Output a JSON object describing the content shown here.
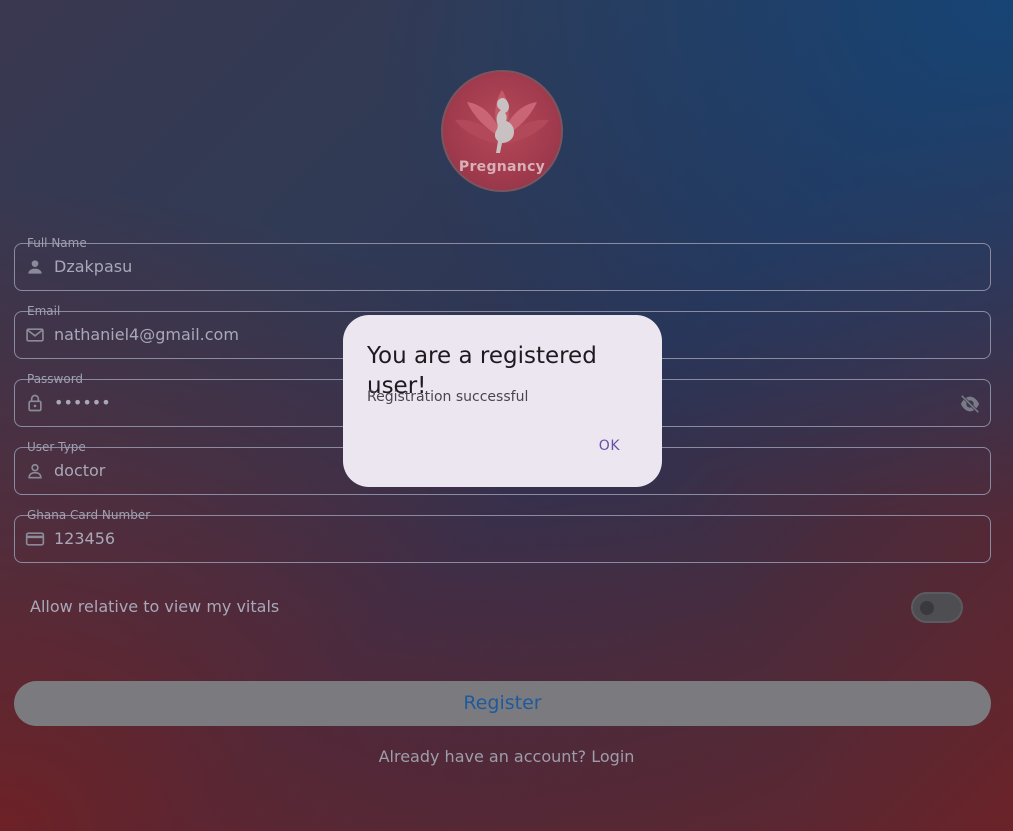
{
  "logo": {
    "text": "Pregnancy"
  },
  "fields": {
    "full_name": {
      "label": "Full Name",
      "value": "Dzakpasu",
      "icon": "person-icon"
    },
    "email": {
      "label": "Email",
      "value": "nathaniel4@gmail.com",
      "icon": "mail-icon"
    },
    "password": {
      "label": "Password",
      "value": "••••••",
      "icon": "lock-icon",
      "trailing_icon": "visibility-off-icon"
    },
    "user_type": {
      "label": "User Type",
      "value": "doctor",
      "icon": "person-icon"
    },
    "ghana_card": {
      "label": "Ghana Card Number",
      "value": "123456",
      "icon": "credit-card-icon"
    }
  },
  "toggle": {
    "label": "Allow relative to view my vitals",
    "on": false
  },
  "register_label": "Register",
  "login_link": "Already have an account? Login",
  "dialog": {
    "title": "You are a registered user!",
    "body": "Registration successful",
    "ok_label": "OK"
  },
  "colors": {
    "accent": "#6750a4",
    "button_text": "#1e5a9c",
    "dialog_bg": "#ece6f0"
  }
}
